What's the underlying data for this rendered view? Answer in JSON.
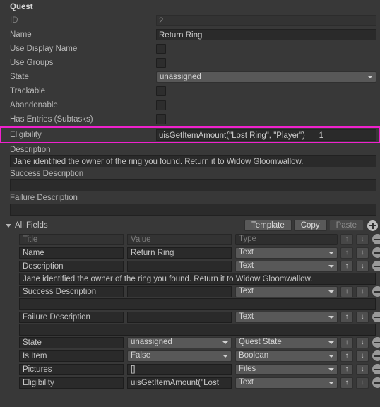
{
  "header": {
    "title": "Quest"
  },
  "properties": [
    {
      "label": "ID",
      "type": "text",
      "value": "2",
      "readonly": true
    },
    {
      "label": "Name",
      "type": "text",
      "value": "Return Ring",
      "readonly": false
    },
    {
      "label": "Use Display Name",
      "type": "checkbox",
      "checked": false
    },
    {
      "label": "Use Groups",
      "type": "checkbox",
      "checked": false
    },
    {
      "label": "State",
      "type": "popup",
      "value": "unassigned"
    },
    {
      "label": "Trackable",
      "type": "checkbox",
      "checked": false
    },
    {
      "label": "Abandonable",
      "type": "checkbox",
      "checked": false
    },
    {
      "label": "Has Entries (Subtasks)",
      "type": "checkbox",
      "checked": false
    },
    {
      "label": "Eligibility",
      "type": "text",
      "value": "uisGetItemAmount(\"Lost Ring\", \"Player\") == 1",
      "highlighted": true
    }
  ],
  "text_blocks": [
    {
      "label": "Description",
      "value": "Jane identified the owner of the ring you found. Return it to Widow Gloomwallow."
    },
    {
      "label": "Success Description",
      "value": ""
    },
    {
      "label": "Failure Description",
      "value": ""
    }
  ],
  "all_fields": {
    "foldout_label": "All Fields",
    "expanded": true,
    "buttons": {
      "template": "Template",
      "copy": "Copy",
      "paste": "Paste",
      "paste_disabled": true
    },
    "add_icon": "plus-circle-icon",
    "remove_icon": "minus-circle-icon",
    "move_up_icon": "arrow-up-icon",
    "move_down_icon": "arrow-down-icon",
    "columns": {
      "title": "Title",
      "value": "Value",
      "type": "Type"
    },
    "rows": [
      {
        "title": "",
        "title_placeholder": "Title",
        "value": "",
        "value_placeholder": "Value",
        "type": "",
        "type_placeholder": "Type",
        "is_placeholder": true,
        "up_enabled": false,
        "down_enabled": false,
        "subrow": null
      },
      {
        "title": "Name",
        "value": "Return Ring",
        "type": "Text",
        "is_placeholder": false,
        "up_enabled": false,
        "down_enabled": true,
        "subrow": null
      },
      {
        "title": "Description",
        "value": "",
        "type": "Text",
        "is_placeholder": false,
        "up_enabled": true,
        "down_enabled": true,
        "subrow": "Jane identified the owner of the ring you found. Return it to Widow Gloomwallow."
      },
      {
        "title": "Success Description",
        "value": "",
        "type": "Text",
        "is_placeholder": false,
        "up_enabled": true,
        "down_enabled": true,
        "subrow": ""
      },
      {
        "title": "Failure Description",
        "value": "",
        "type": "Text",
        "is_placeholder": false,
        "up_enabled": true,
        "down_enabled": true,
        "subrow": ""
      },
      {
        "title": "State",
        "value": "unassigned",
        "value_is_popup": true,
        "type": "Quest State",
        "is_placeholder": false,
        "up_enabled": true,
        "down_enabled": true,
        "subrow": null
      },
      {
        "title": "Is Item",
        "value": "False",
        "value_is_popup": true,
        "type": "Boolean",
        "is_placeholder": false,
        "up_enabled": true,
        "down_enabled": true,
        "subrow": null
      },
      {
        "title": "Pictures",
        "value": "[]",
        "type": "Files",
        "is_placeholder": false,
        "up_enabled": true,
        "down_enabled": true,
        "subrow": null
      },
      {
        "title": "Eligibility",
        "value": "uisGetItemAmount(\"Lost",
        "type": "Text",
        "is_placeholder": false,
        "up_enabled": true,
        "down_enabled": false,
        "underline_highlight": true,
        "subrow": null
      }
    ]
  },
  "colors": {
    "background": "#383838",
    "field_bg": "#2a2a2a",
    "popup_bg": "#585858",
    "highlight": "#ef21cd",
    "text": "#c6c6c6",
    "text_dim": "#7b7b7b"
  }
}
